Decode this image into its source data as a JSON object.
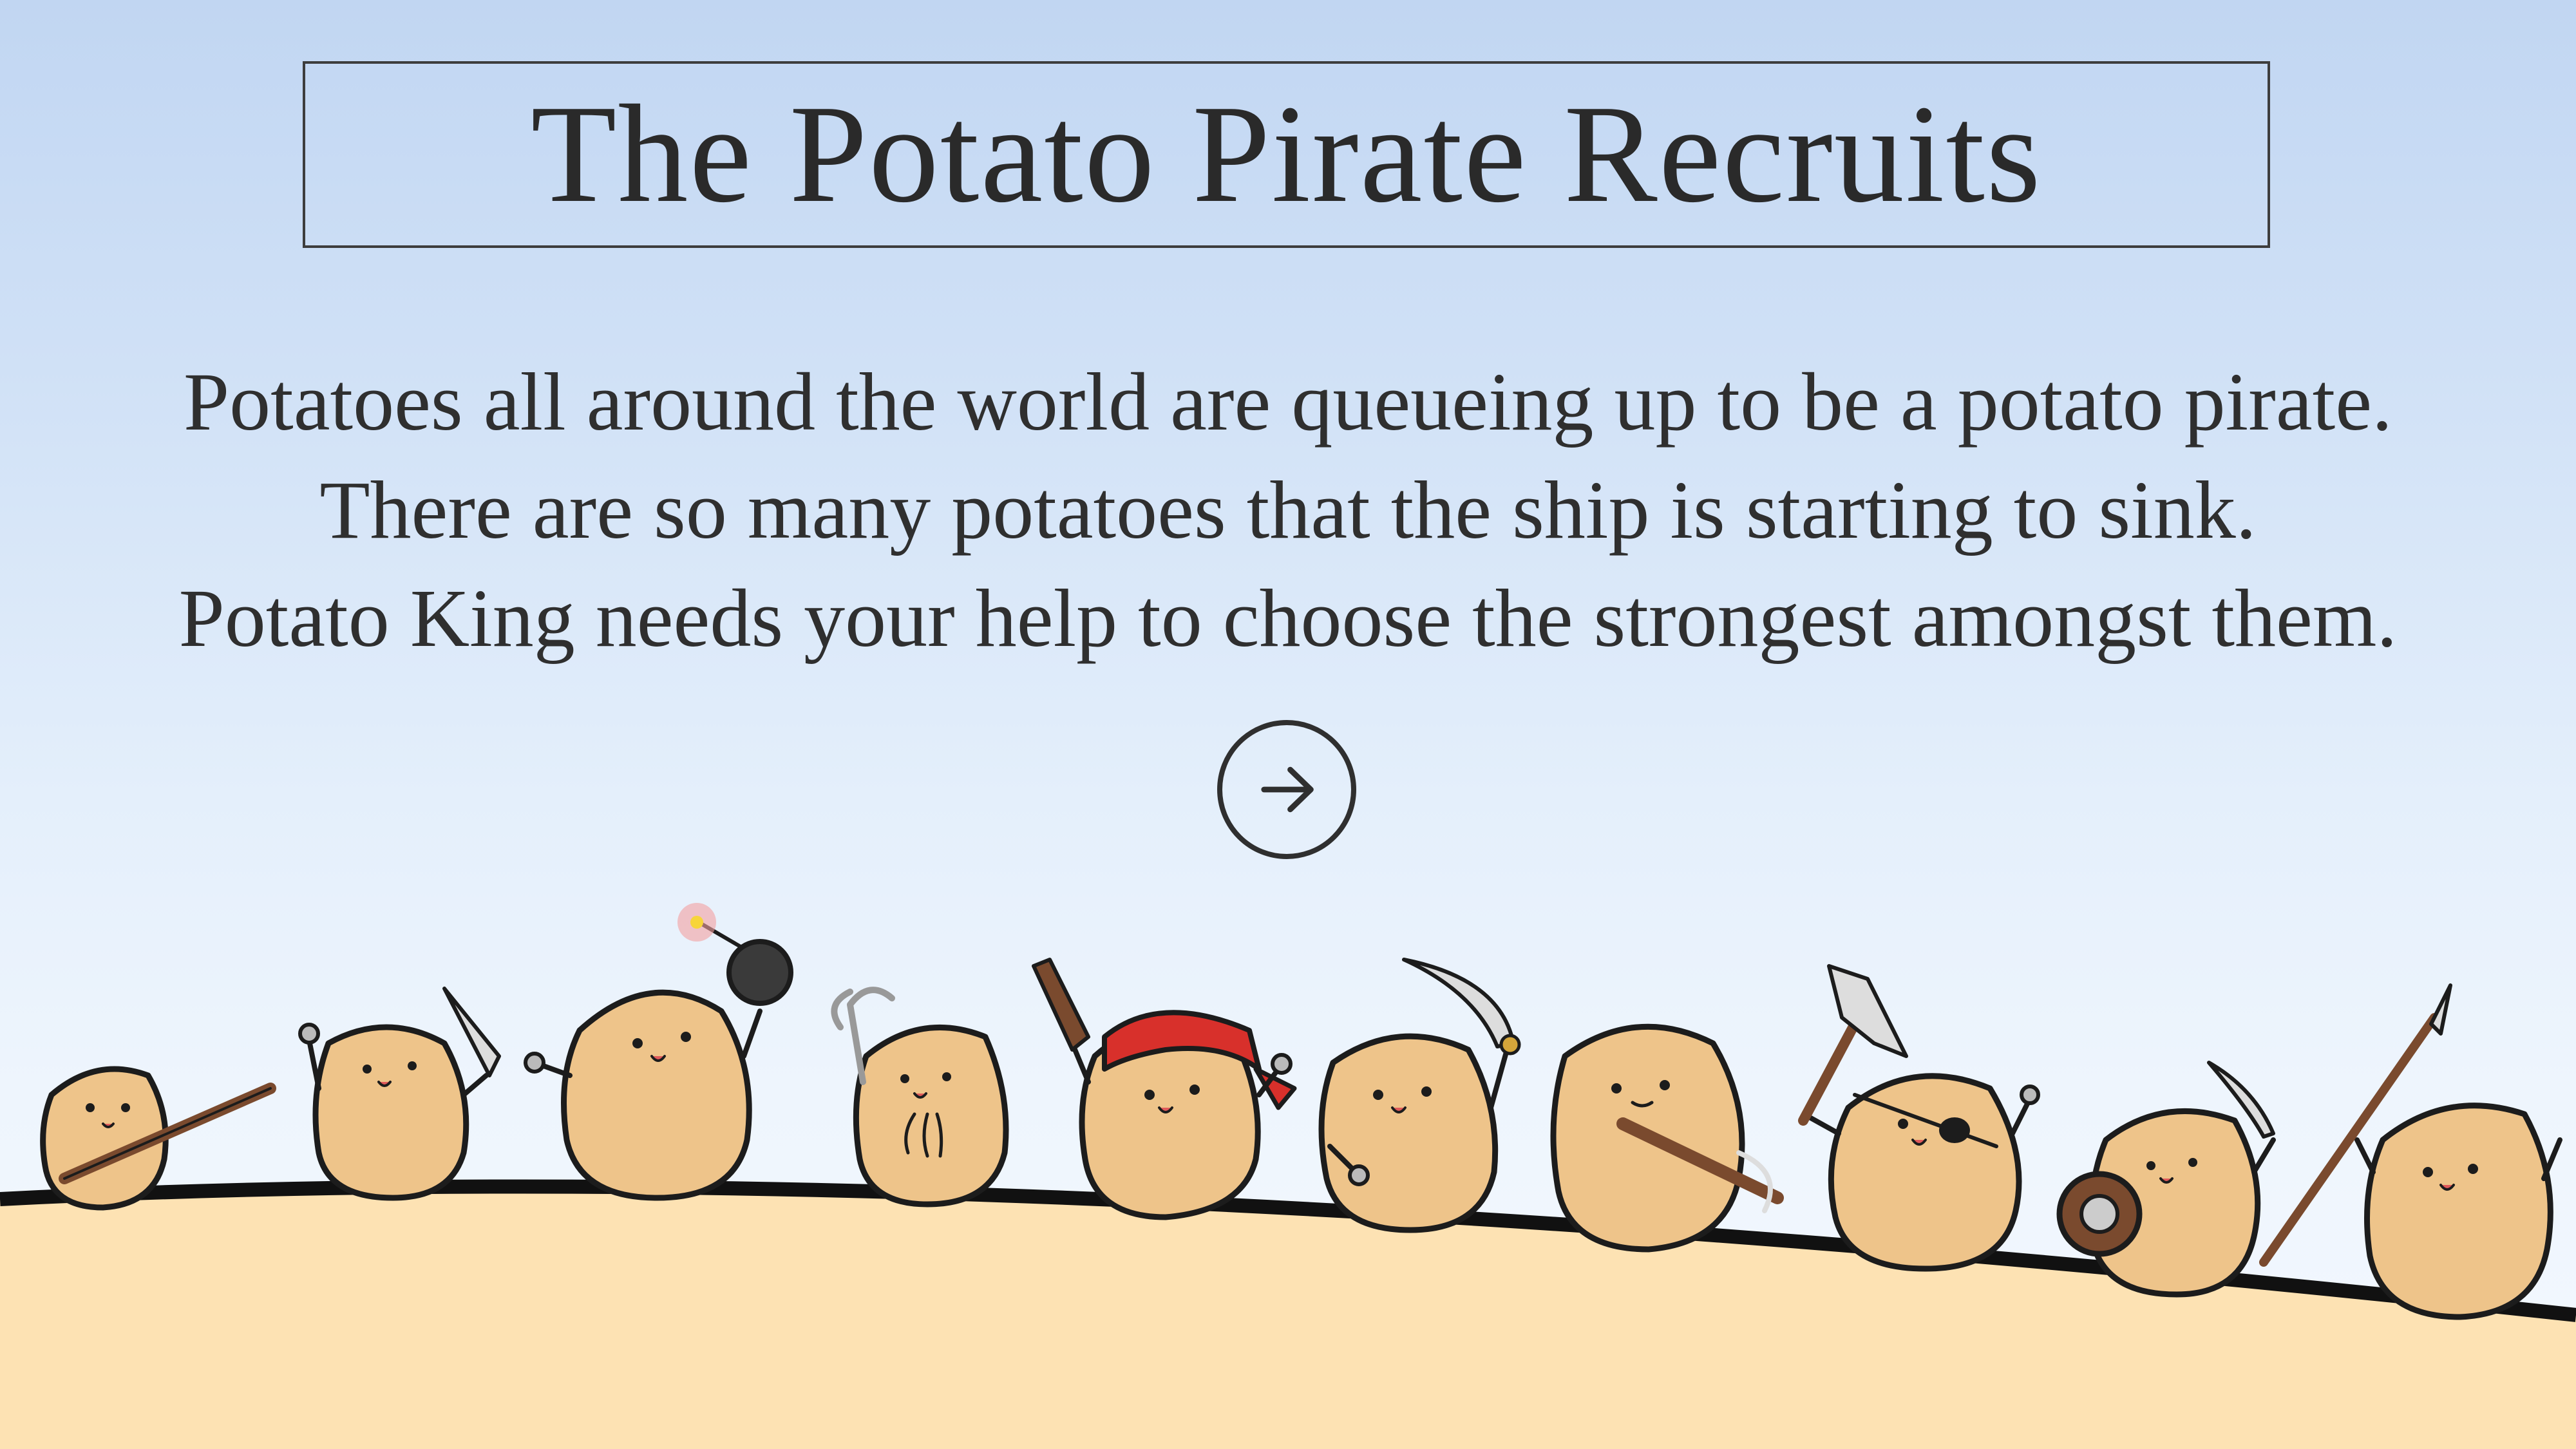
{
  "title": "The Potato Pirate Recruits",
  "intro": {
    "line1": "Potatoes all around the world are queueing up to be a potato pirate.",
    "line2": "There are so many potatoes that the ship is starting to sink.",
    "line3": "Potato King needs your help to choose the strongest amongst them."
  },
  "next_button": {
    "icon": "arrow-right-icon"
  },
  "colors": {
    "ground": "#fde2b3",
    "ground_edge": "#111111",
    "potato": "#eec48a",
    "potato_outline": "#1c1c1c",
    "bandana": "#d8302b",
    "text": "#2f2f2f"
  },
  "recruits": [
    {
      "name": "potato-musket",
      "weapon": "musket"
    },
    {
      "name": "potato-dagger",
      "weapon": "dagger"
    },
    {
      "name": "potato-bomb",
      "weapon": "bomb"
    },
    {
      "name": "potato-grappling-hook",
      "weapon": "grappling-hook"
    },
    {
      "name": "potato-bandana-pistol",
      "weapon": "pistol"
    },
    {
      "name": "potato-cutlass",
      "weapon": "cutlass"
    },
    {
      "name": "potato-crossbow",
      "weapon": "crossbow"
    },
    {
      "name": "potato-eyepatch-axe",
      "weapon": "axe"
    },
    {
      "name": "potato-shield-knife",
      "weapon": "shield"
    },
    {
      "name": "potato-spear",
      "weapon": "spear"
    }
  ]
}
